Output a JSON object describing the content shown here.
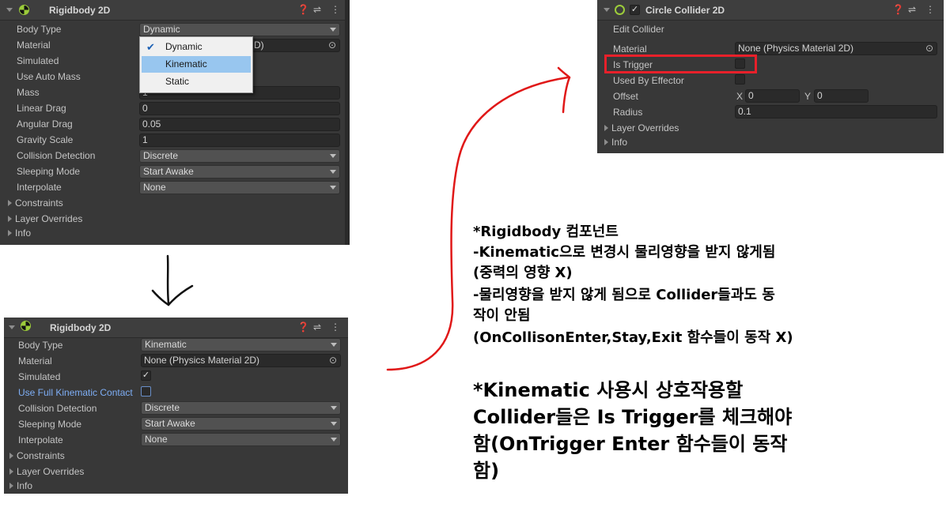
{
  "panel1": {
    "title": "Rigidbody 2D",
    "rows": {
      "body_type": {
        "label": "Body Type",
        "value": "Dynamic"
      },
      "material": {
        "label": "Material",
        "value_tail": "D)"
      },
      "simulated": {
        "label": "Simulated"
      },
      "use_auto_mass": {
        "label": "Use Auto Mass"
      },
      "mass": {
        "label": "Mass",
        "value": "1"
      },
      "linear_drag": {
        "label": "Linear Drag",
        "value": "0"
      },
      "angular_drag": {
        "label": "Angular Drag",
        "value": "0.05"
      },
      "gravity_scale": {
        "label": "Gravity Scale",
        "value": "1"
      },
      "collision_detection": {
        "label": "Collision Detection",
        "value": "Discrete"
      },
      "sleeping_mode": {
        "label": "Sleeping Mode",
        "value": "Start Awake"
      },
      "interpolate": {
        "label": "Interpolate",
        "value": "None"
      }
    },
    "foldouts": {
      "constraints": "Constraints",
      "layer_overrides": "Layer Overrides",
      "info": "Info"
    },
    "popup": {
      "options": [
        "Dynamic",
        "Kinematic",
        "Static"
      ],
      "selected": "Dynamic",
      "highlighted": "Kinematic"
    }
  },
  "panel2": {
    "title": "Rigidbody 2D",
    "rows": {
      "body_type": {
        "label": "Body Type",
        "value": "Kinematic"
      },
      "material": {
        "label": "Material",
        "value": "None (Physics Material 2D)"
      },
      "simulated": {
        "label": "Simulated",
        "checked": true
      },
      "use_full_kinematic_contact": {
        "label": "Use Full Kinematic Contact",
        "checked": false
      },
      "collision_detection": {
        "label": "Collision Detection",
        "value": "Discrete"
      },
      "sleeping_mode": {
        "label": "Sleeping Mode",
        "value": "Start Awake"
      },
      "interpolate": {
        "label": "Interpolate",
        "value": "None"
      }
    },
    "foldouts": {
      "constraints": "Constraints",
      "layer_overrides": "Layer Overrides",
      "info": "Info"
    }
  },
  "panel3": {
    "title": "Circle Collider 2D",
    "edit_collider": "Edit Collider",
    "rows": {
      "material": {
        "label": "Material",
        "value": "None (Physics Material 2D)"
      },
      "is_trigger": {
        "label": "Is Trigger",
        "checked": false
      },
      "used_by_effector": {
        "label": "Used By Effector",
        "checked": false
      },
      "offset": {
        "label": "Offset",
        "x_label": "X",
        "x": "0",
        "y_label": "Y",
        "y": "0"
      },
      "radius": {
        "label": "Radius",
        "value": "0.1"
      }
    },
    "foldouts": {
      "layer_overrides": "Layer Overrides",
      "info": "Info"
    }
  },
  "annotations": {
    "note1": [
      "*Rigidbody 컴포넌트",
      "-Kinematic으로 변경시 물리영향을 받지 않게됨",
      "(중력의 영향 X)",
      "-물리영향을 받지 않게 됨으로 Collider들과도 동",
      "작이 안됨",
      "(OnCollisonEnter,Stay,Exit 함수들이 동작 X)"
    ],
    "note2": [
      "*Kinematic 사용시 상호작용할",
      "Collider들은 Is Trigger를 체크해야",
      "함(OnTrigger Enter 함수들이 동작",
      "함)"
    ],
    "highlight_color": "#e8202a",
    "arrow_color": "#e01818"
  },
  "icons": {
    "rigidbody": "rigidbody-icon",
    "collider": "circle-collider-icon",
    "help": "help-icon",
    "settings": "preset-settings-icon",
    "menu": "kebab-menu-icon",
    "object_picker": "object-picker-icon"
  }
}
